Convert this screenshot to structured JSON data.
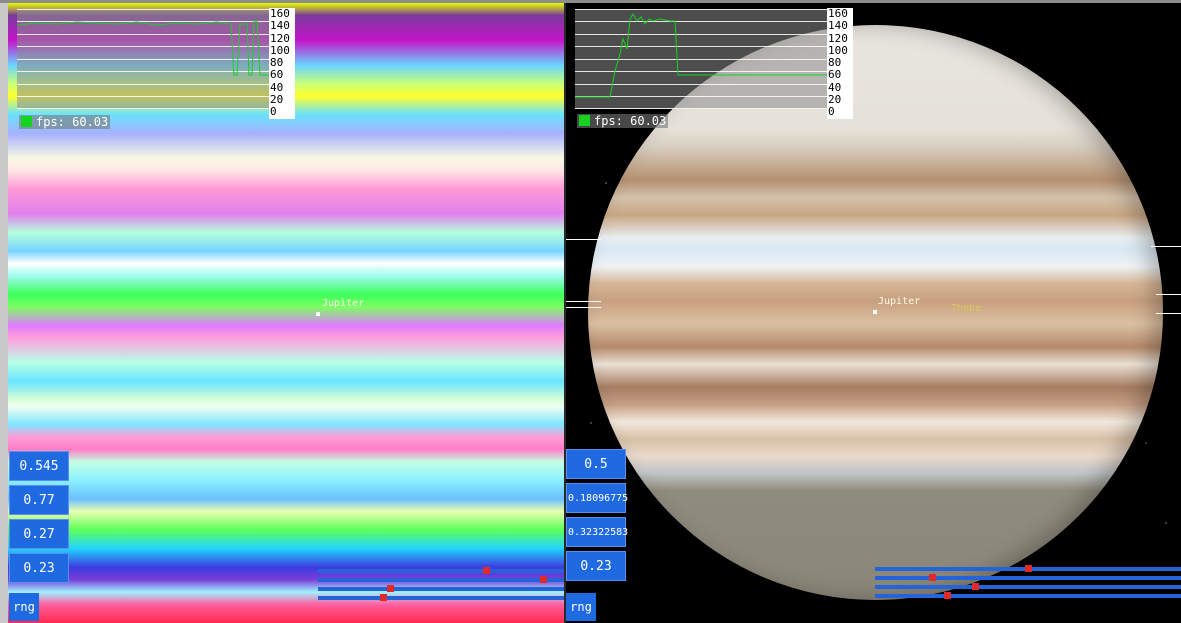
{
  "left": {
    "fps": "fps: 60.03",
    "ticks": [
      "160",
      "140",
      "120",
      "100",
      "80",
      "60",
      "40",
      "20",
      "0"
    ],
    "values": [
      "0.545",
      "0.77",
      "0.27",
      "0.23"
    ],
    "rng_label": "rng",
    "planet_label": "Jupiter",
    "sliders": [
      0.69,
      0.93,
      0.29,
      0.26
    ]
  },
  "right": {
    "fps": "fps: 60.03",
    "ticks": [
      "160",
      "140",
      "120",
      "100",
      "80",
      "60",
      "40",
      "20",
      "0"
    ],
    "values": [
      "0.5",
      "0.18096775",
      "0.32322583",
      "0.23"
    ],
    "rng_label": "rng",
    "planet_label": "Jupiter",
    "moon_label": "Thebe",
    "sliders": [
      0.5,
      0.18096775,
      0.32322583,
      0.23
    ]
  },
  "colors": {
    "button": "#1f6ae0",
    "knob": "#e02a2a",
    "fps_line": "#13d421"
  }
}
